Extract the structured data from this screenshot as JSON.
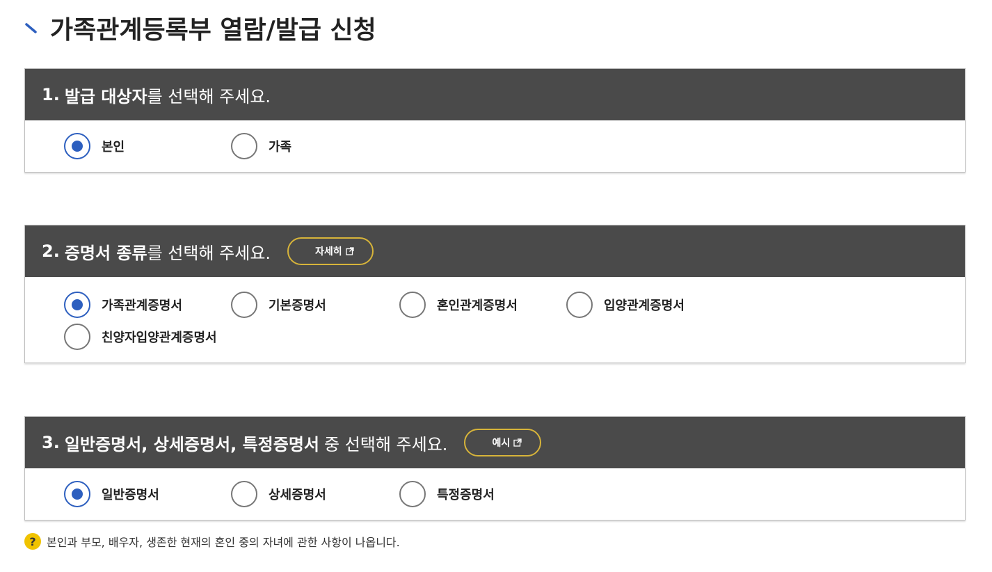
{
  "page": {
    "title": "가족관계등록부 열람/발급 신청"
  },
  "section1": {
    "number": "1.",
    "title_bold": "발급 대상자",
    "title_rest": "를 선택해 주세요.",
    "options": [
      {
        "label": "본인",
        "selected": true
      },
      {
        "label": "가족",
        "selected": false
      }
    ]
  },
  "section2": {
    "number": "2.",
    "title_bold": "증명서 종류",
    "title_rest": "를 선택해 주세요.",
    "button_label": "자세히",
    "button_icon": "external-link-icon",
    "options": [
      {
        "label": "가족관계증명서",
        "selected": true
      },
      {
        "label": "기본증명서",
        "selected": false
      },
      {
        "label": "혼인관계증명서",
        "selected": false
      },
      {
        "label": "입양관계증명서",
        "selected": false
      },
      {
        "label": "친양자입양관계증명서",
        "selected": false
      }
    ]
  },
  "section3": {
    "number": "3.",
    "title_bold": "일반증명서, 상세증명서, 특정증명서",
    "title_rest": "중 선택해 주세요.",
    "button_label": "예시",
    "button_icon": "external-link-icon",
    "options": [
      {
        "label": "일반증명서",
        "selected": true
      },
      {
        "label": "상세증명서",
        "selected": false
      },
      {
        "label": "특정증명서",
        "selected": false
      }
    ]
  },
  "note": {
    "icon": "?",
    "text": "본인과 부모, 배우자, 생존한 현재의 혼인 중의 자녀에 관한 사항이 나옵니다."
  },
  "colors": {
    "header_bg": "#4a4a4a",
    "radio_selected": "#2d5fbf",
    "button_border": "#d7b43a",
    "help_icon": "#f0c300"
  }
}
